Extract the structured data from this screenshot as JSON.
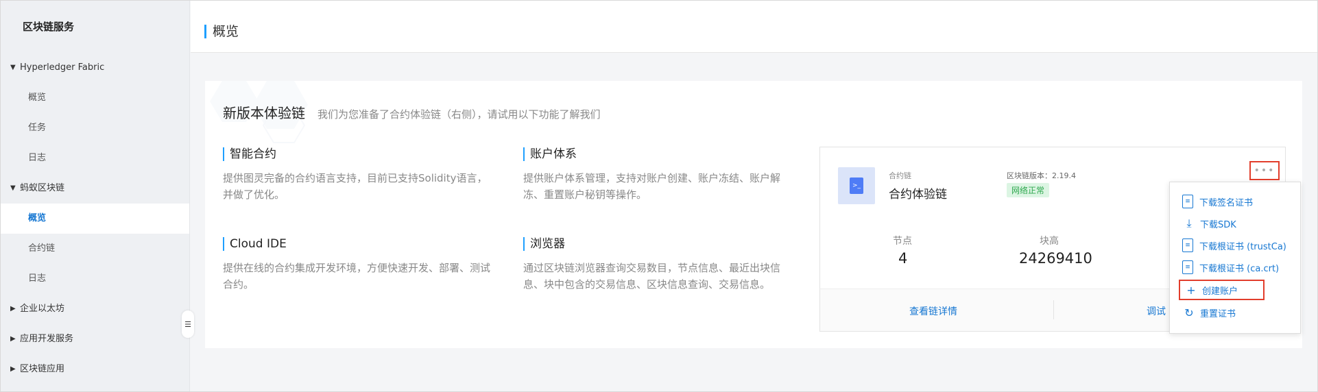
{
  "sidebar": {
    "brand": "区块链服务",
    "groups": [
      {
        "label": "Hyperledger Fabric",
        "expanded": true,
        "items": [
          "概览",
          "任务",
          "日志"
        ]
      },
      {
        "label": "蚂蚁区块链",
        "expanded": true,
        "items": [
          "概览",
          "合约链",
          "日志"
        ]
      },
      {
        "label": "企业以太坊",
        "expanded": false
      },
      {
        "label": "应用开发服务",
        "expanded": false
      },
      {
        "label": "区块链应用",
        "expanded": false
      }
    ],
    "active_item": "蚂蚁区块链 > 概览"
  },
  "header": {
    "title": "概览"
  },
  "intro": {
    "heading": "新版本体验链",
    "subtitle": "我们为您准备了合约体验链（右侧），请试用以下功能了解我们"
  },
  "features": [
    {
      "title": "智能合约",
      "desc": "提供图灵完备的合约语言支持，目前已支持Solidity语言，并做了优化。"
    },
    {
      "title": "账户体系",
      "desc": "提供账户体系管理，支持对账户创建、账户冻结、账户解冻、重置账户秘钥等操作。"
    },
    {
      "title": "Cloud IDE",
      "desc": "提供在线的合约集成开发环境，方便快速开发、部署、测试合约。"
    },
    {
      "title": "浏览器",
      "desc": "通过区块链浏览器查询交易数目，节点信息、最近出块信息、块中包含的交易信息、区块信息查询、交易信息。"
    }
  ],
  "chain": {
    "type_label": "合约链",
    "name": "合约体验链",
    "version_label": "区块链版本：2.19.4",
    "status": "网络正常",
    "more_label": "•••",
    "stats": [
      {
        "label": "节点",
        "value": "4"
      },
      {
        "label": "块高",
        "value": "24269410"
      }
    ],
    "links": {
      "details": "查看链详情",
      "debug": "调试"
    }
  },
  "menu": {
    "items": [
      "下载签名证书",
      "下载SDK",
      "下载根证书 (trustCa)",
      "下载根证书 (ca.crt)",
      "创建账户",
      "重置证书"
    ]
  },
  "colors": {
    "accent": "#1e9fff",
    "link": "#1677d2",
    "highlight": "#e23d2b",
    "status_green": "#2fa84f"
  }
}
